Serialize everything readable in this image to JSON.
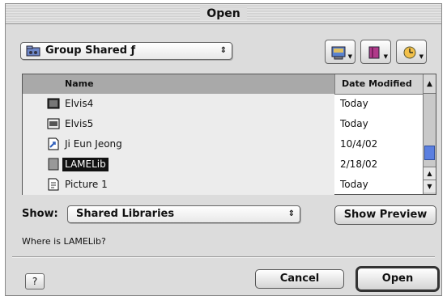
{
  "window": {
    "title": "Open"
  },
  "location": {
    "label": "Group Shared ƒ",
    "arrows": "⇕"
  },
  "toolbar": {
    "buttons": [
      {
        "name": "desktop-menu-icon"
      },
      {
        "name": "favorites-menu-icon"
      },
      {
        "name": "recent-menu-icon"
      }
    ]
  },
  "list": {
    "columns": {
      "name": "Name",
      "date": "Date Modified"
    },
    "sort_glyph": "▲",
    "rows": [
      {
        "name": "Elvis4",
        "date": "Today",
        "icon": "image-file-icon"
      },
      {
        "name": "Elvis5",
        "date": "Today",
        "icon": "image-file-icon"
      },
      {
        "name": "Ji Eun Jeong",
        "date": "10/4/02",
        "icon": "alias-file-icon"
      },
      {
        "name": "LAMELib",
        "date": "2/18/02",
        "icon": "library-file-icon",
        "selected": true
      },
      {
        "name": "Picture 1",
        "date": "Today",
        "icon": "document-file-icon"
      }
    ],
    "scroll_up": "▲",
    "scroll_down": "▼"
  },
  "show": {
    "label": "Show:",
    "value": "Shared Libraries",
    "arrows": "⇕",
    "preview_button": "Show Preview"
  },
  "prompt": "Where is LAMELib?",
  "footer": {
    "help_glyph": "?",
    "cancel": "Cancel",
    "open": "Open"
  },
  "colors": {
    "window_bg": "#dcdcdc",
    "selection": "#111111",
    "scroll_thumb": "#5b7fe0"
  }
}
